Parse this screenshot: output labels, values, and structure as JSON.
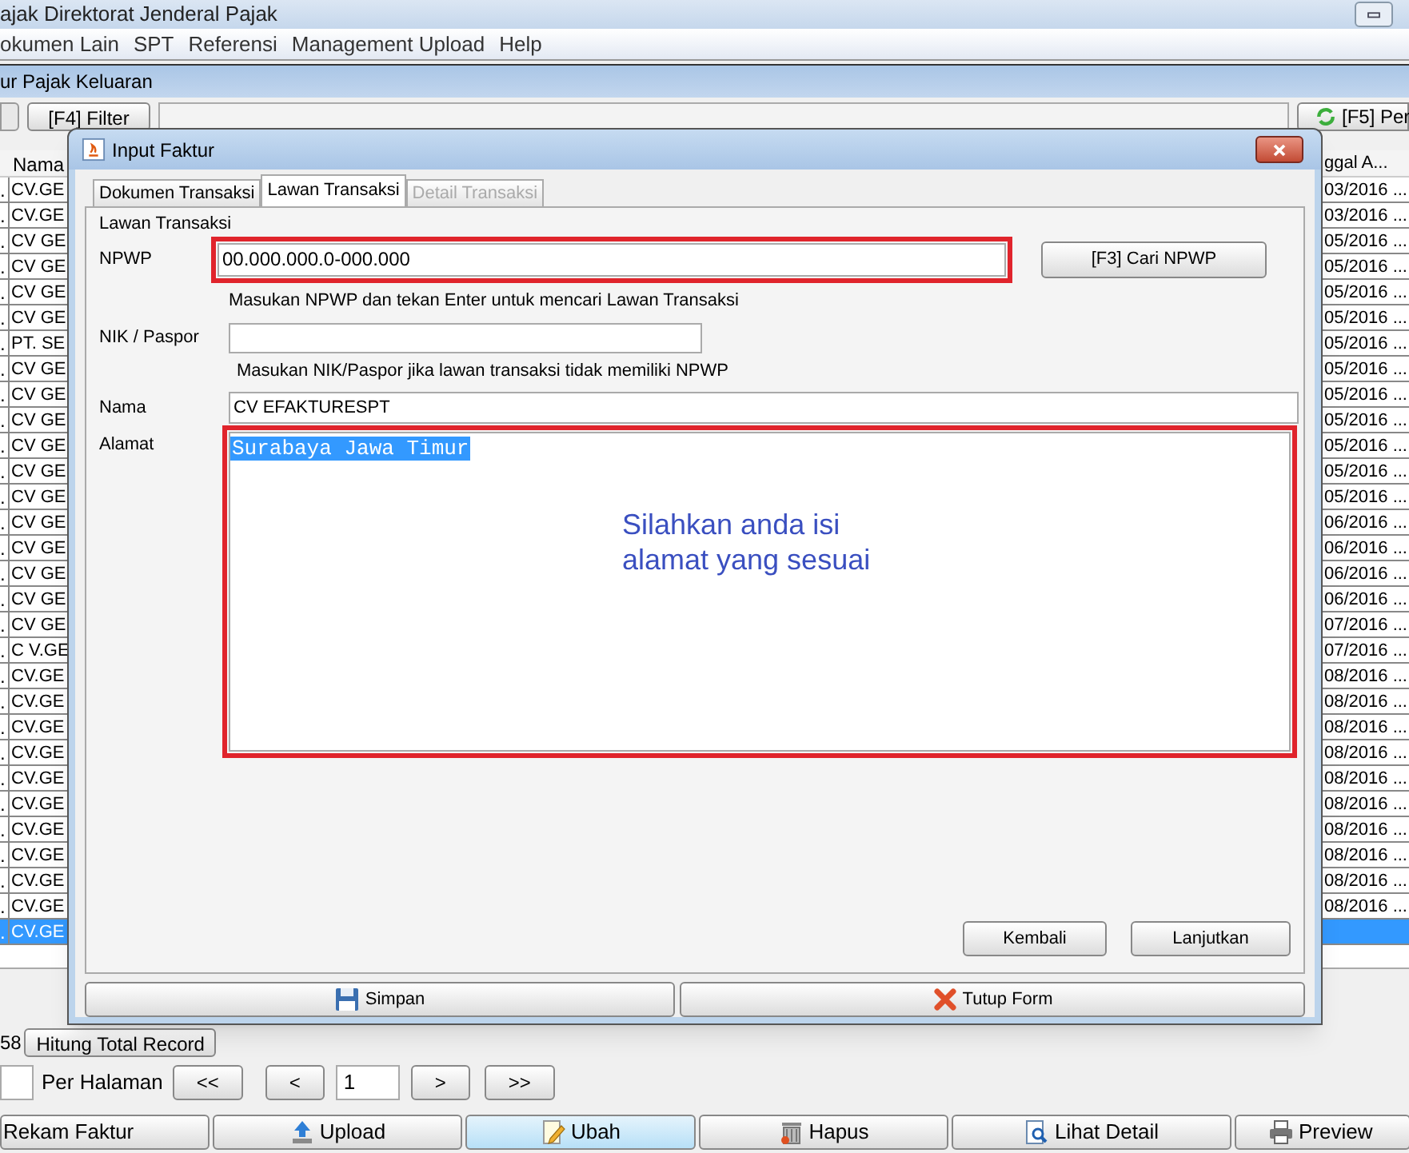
{
  "app": {
    "title": "ajak Direktorat Jenderal Pajak",
    "menu": [
      "okumen Lain",
      "SPT",
      "Referensi",
      "Management Upload",
      "Help"
    ]
  },
  "frame": {
    "title": "ur Pajak Keluaran",
    "filter_button": "[F4] Filter",
    "refresh_button": "[F5] Per"
  },
  "table": {
    "columns": [
      "Nama",
      "ggal A..."
    ],
    "rows": [
      {
        "column_1": ".",
        "nama": "CV.GE",
        "tanggal": "03/2016 ...",
        "selected": false
      },
      {
        "column_1": ".",
        "nama": "CV.GE",
        "tanggal": "03/2016 ...",
        "selected": false
      },
      {
        "column_1": ".",
        "nama": "CV GE",
        "tanggal": "05/2016 ...",
        "selected": false
      },
      {
        "column_1": ".",
        "nama": "CV GE",
        "tanggal": "05/2016 ...",
        "selected": false
      },
      {
        "column_1": ".",
        "nama": "CV GE",
        "tanggal": "05/2016 ...",
        "selected": false
      },
      {
        "column_1": ".",
        "nama": "CV GE",
        "tanggal": "05/2016 ...",
        "selected": false
      },
      {
        "column_1": ".",
        "nama": "PT. SE",
        "tanggal": "05/2016 ...",
        "selected": false
      },
      {
        "column_1": ".",
        "nama": "CV GE",
        "tanggal": "05/2016 ...",
        "selected": false
      },
      {
        "column_1": ".",
        "nama": "CV GE",
        "tanggal": "05/2016 ...",
        "selected": false
      },
      {
        "column_1": ".",
        "nama": "CV GE",
        "tanggal": "05/2016 ...",
        "selected": false
      },
      {
        "column_1": ".",
        "nama": "CV GE",
        "tanggal": "05/2016 ...",
        "selected": false
      },
      {
        "column_1": ".",
        "nama": "CV GE",
        "tanggal": "05/2016 ...",
        "selected": false
      },
      {
        "column_1": ".",
        "nama": "CV GE",
        "tanggal": "05/2016 ...",
        "selected": false
      },
      {
        "column_1": ".",
        "nama": "CV GE",
        "tanggal": "06/2016 ...",
        "selected": false
      },
      {
        "column_1": ".",
        "nama": "CV GE",
        "tanggal": "06/2016 ...",
        "selected": false
      },
      {
        "column_1": ".",
        "nama": "CV GE",
        "tanggal": "06/2016 ...",
        "selected": false
      },
      {
        "column_1": ".",
        "nama": "CV GE",
        "tanggal": "06/2016 ...",
        "selected": false
      },
      {
        "column_1": ".",
        "nama": "CV GE",
        "tanggal": "07/2016 ...",
        "selected": false
      },
      {
        "column_1": ".",
        "nama": "C V.GE",
        "tanggal": "07/2016 ...",
        "selected": false
      },
      {
        "column_1": ".",
        "nama": "CV.GE",
        "tanggal": "08/2016 ...",
        "selected": false
      },
      {
        "column_1": ".",
        "nama": "CV.GE",
        "tanggal": "08/2016 ...",
        "selected": false
      },
      {
        "column_1": ".",
        "nama": "CV.GE",
        "tanggal": "08/2016 ...",
        "selected": false
      },
      {
        "column_1": ".",
        "nama": "CV.GE",
        "tanggal": "08/2016 ...",
        "selected": false
      },
      {
        "column_1": ".",
        "nama": "CV.GE",
        "tanggal": "08/2016 ...",
        "selected": false
      },
      {
        "column_1": ".",
        "nama": "CV.GE",
        "tanggal": "08/2016 ...",
        "selected": false
      },
      {
        "column_1": ".",
        "nama": "CV.GE",
        "tanggal": "08/2016 ...",
        "selected": false
      },
      {
        "column_1": ".",
        "nama": "CV.GE",
        "tanggal": "08/2016 ...",
        "selected": false
      },
      {
        "column_1": ".",
        "nama": "CV.GE",
        "tanggal": "08/2016 ...",
        "selected": false
      },
      {
        "column_1": ".",
        "nama": "CV.GE",
        "tanggal": "08/2016 ...",
        "selected": false
      },
      {
        "column_1": ".",
        "nama": "CV.GE",
        "selected": true
      }
    ]
  },
  "record_count": "58",
  "count_button": "Hitung Total Record",
  "pagination": {
    "per_page_label": "Per Halaman",
    "first": "<<",
    "prev": "<",
    "page": "1",
    "next": ">",
    "last": ">>"
  },
  "actions": [
    {
      "label": "Rekam Faktur",
      "kind": "none",
      "selected": false
    },
    {
      "label": "Upload",
      "kind": "upload",
      "selected": false
    },
    {
      "label": "Ubah",
      "kind": "edit",
      "selected": true
    },
    {
      "label": "Hapus",
      "kind": "delete",
      "selected": false
    },
    {
      "label": "Lihat Detail",
      "kind": "detail",
      "selected": false
    },
    {
      "label": "Preview",
      "kind": "print",
      "selected": false
    }
  ],
  "dialog": {
    "title": "Input Faktur",
    "tabs": [
      {
        "label": "Dokumen Transaksi",
        "selected": false,
        "disabled": false
      },
      {
        "label": "Lawan Transaksi",
        "selected": true,
        "disabled": false
      },
      {
        "label": "Detail Transaksi",
        "selected": false,
        "disabled": true
      }
    ],
    "group_title": "Lawan Transaksi",
    "npwp": {
      "label": "NPWP",
      "value": "00.000.000.0-000.000",
      "hint": "Masukan NPWP dan tekan Enter untuk mencari Lawan Transaksi",
      "highlighted": true
    },
    "npwp_button": "[F3] Cari NPWP",
    "nik": {
      "label": "NIK / Paspor",
      "hint": "Masukan NIK/Paspor jika lawan transaksi tidak memiliki NPWP",
      "highlighted": false
    },
    "nama": {
      "label": "Nama",
      "value": "CV EFAKTURESPT",
      "highlighted": false
    },
    "alamat": {
      "label": "Alamat",
      "value": "Surabaya Jawa Timur",
      "text_selected": true,
      "highlighted": true
    },
    "annotation": [
      "Silahkan anda isi",
      "alamat yang sesuai"
    ],
    "nav_buttons": [
      "Kembali",
      "Lanjutkan"
    ],
    "footer_buttons": [
      {
        "label": "Simpan",
        "kind": "save"
      },
      {
        "label": "Tutup Form",
        "kind": "close"
      }
    ]
  }
}
